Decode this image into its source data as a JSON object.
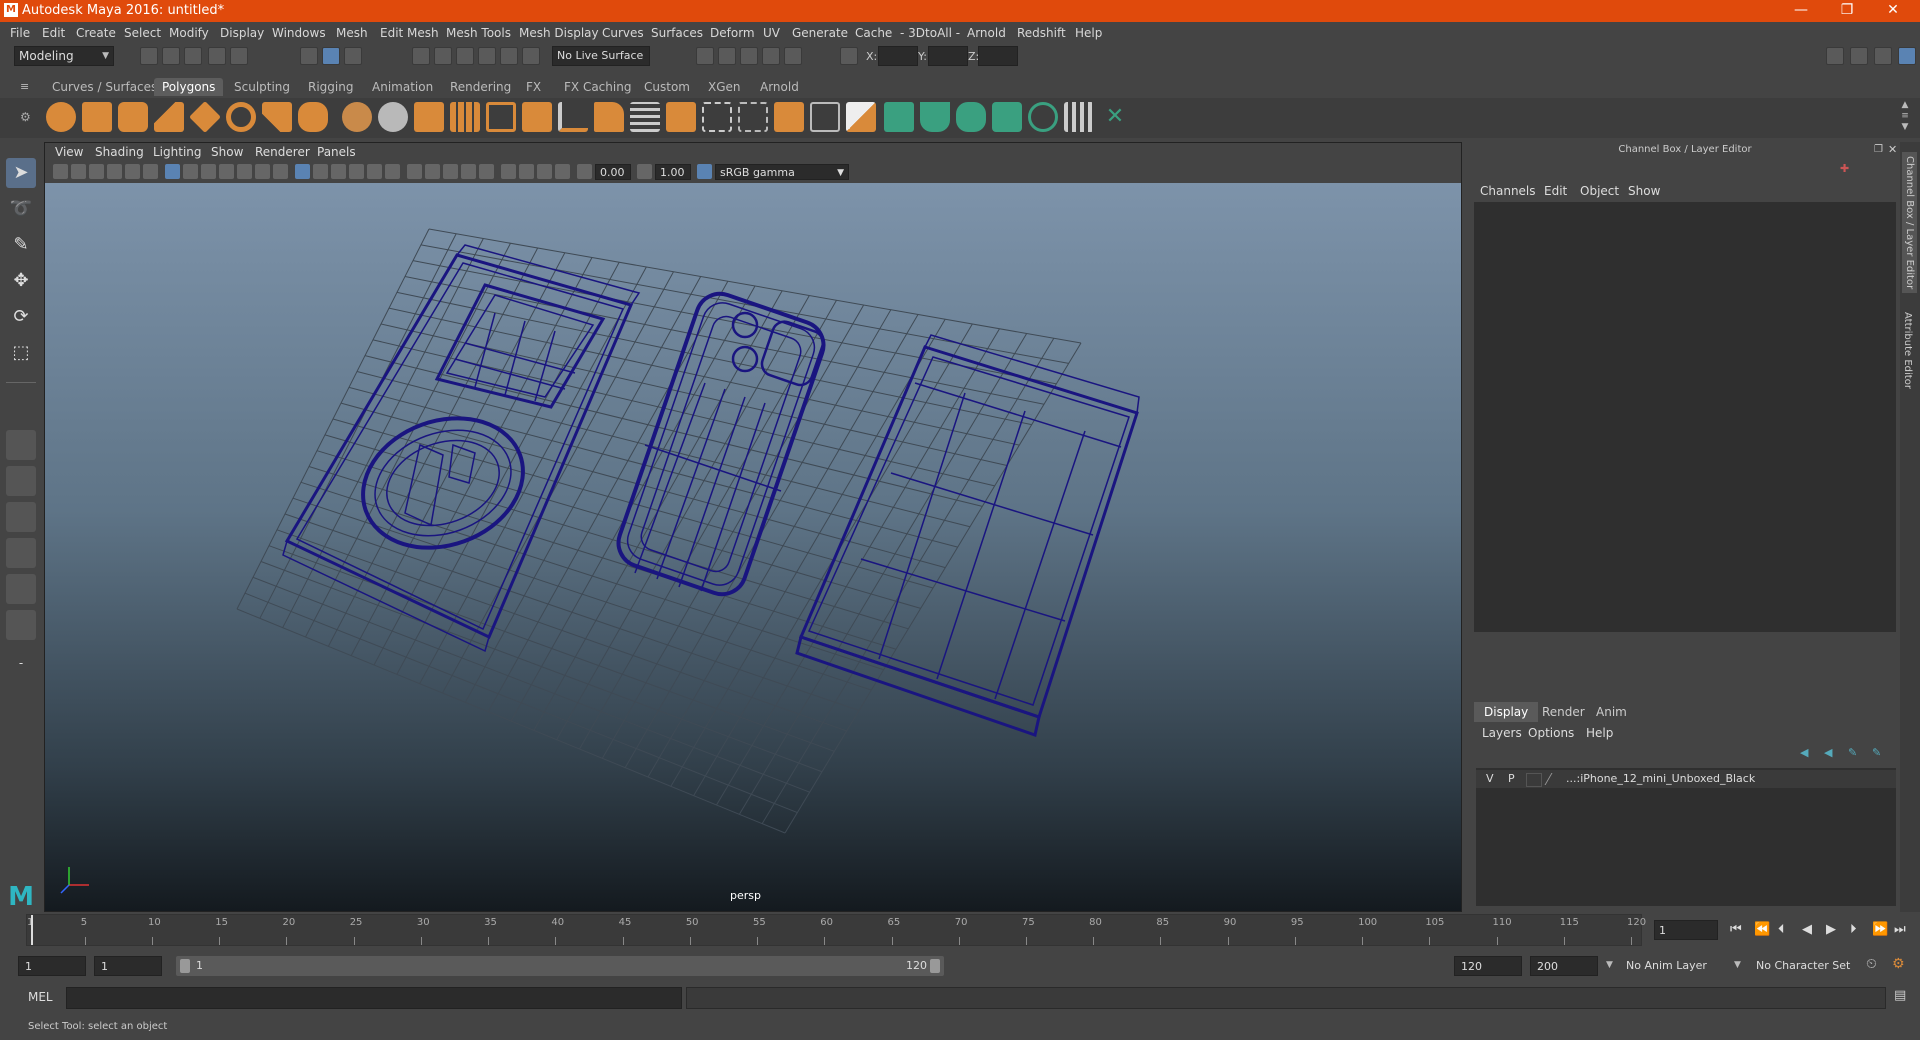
{
  "app": {
    "title": "Autodesk Maya 2016: untitled*",
    "icon_text": "M",
    "window_buttons": [
      "—",
      "❐",
      "✕"
    ]
  },
  "menubar": [
    "File",
    "Edit",
    "Create",
    "Select",
    "Modify",
    "Display",
    "Windows",
    "Mesh",
    "Edit Mesh",
    "Mesh Tools",
    "Mesh Display",
    "Curves",
    "Surfaces",
    "Deform",
    "UV",
    "Generate",
    "Cache",
    "- 3DtoAll -",
    "Arnold",
    "Redshift",
    "Help"
  ],
  "statusline": {
    "mode": "Modeling",
    "live_surface": "No Live Surface",
    "coord_labels": [
      "X:",
      "Y:",
      "Z:"
    ]
  },
  "shelf_tabs": [
    "Curves / Surfaces",
    "Polygons",
    "Sculpting",
    "Rigging",
    "Animation",
    "Rendering",
    "FX",
    "FX Caching",
    "Custom",
    "XGen",
    "Arnold"
  ],
  "shelf_active": "Polygons",
  "viewport": {
    "menu": [
      "View",
      "Shading",
      "Lighting",
      "Show",
      "Renderer",
      "Panels"
    ],
    "exposure": "0.00",
    "gamma": "1.00",
    "color_space": "sRGB gamma",
    "camera": "persp"
  },
  "channel_box": {
    "title": "Channel Box / Layer Editor",
    "menu": [
      "Channels",
      "Edit",
      "Object",
      "Show"
    ]
  },
  "layer_editor": {
    "tabs": [
      "Display",
      "Render",
      "Anim"
    ],
    "menu": [
      "Layers",
      "Options",
      "Help"
    ],
    "layer": {
      "v": "V",
      "p": "P",
      "name": "...:iPhone_12_mini_Unboxed_Black"
    }
  },
  "side_tabs": [
    "Channel Box / Layer Editor",
    "Attribute Editor"
  ],
  "timeline": {
    "ticks": [
      "1",
      "5",
      "10",
      "15",
      "20",
      "25",
      "30",
      "35",
      "40",
      "45",
      "50",
      "55",
      "60",
      "65",
      "70",
      "75",
      "80",
      "85",
      "90",
      "95",
      "100",
      "105",
      "110",
      "115",
      "120"
    ],
    "current_frame": "1"
  },
  "range": {
    "start": "1",
    "playback_start": "1",
    "slider_start": "1",
    "slider_end": "120",
    "playback_end": "120",
    "end": "200",
    "anim_layer": "No Anim Layer",
    "char_set": "No Character Set"
  },
  "command": {
    "label": "MEL"
  },
  "help_line": "Select Tool: select an object"
}
